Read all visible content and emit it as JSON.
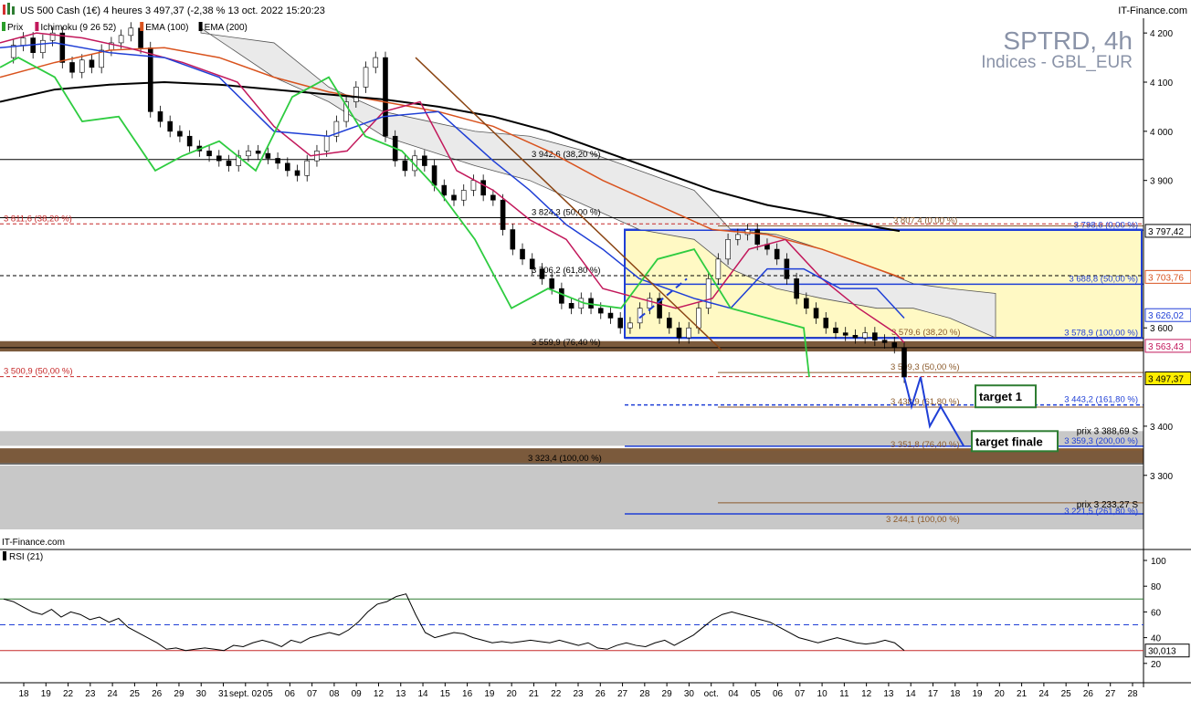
{
  "header": {
    "title": "US 500 Cash (1€) 4 heures 3 497,37 (-2,38 % 13 oct. 2022 15:20:23",
    "source": "IT-Finance.com"
  },
  "legend": [
    {
      "label": "Prix",
      "color": "#2a9d2a"
    },
    {
      "label": "Ichimoku (9 26 52)",
      "color": "#c2185b"
    },
    {
      "label": "EMA (100)",
      "color": "#d9531e"
    },
    {
      "label": "EMA (200)",
      "color": "#000000"
    }
  ],
  "watermark": {
    "symbol": "SPTRD, 4h",
    "sub": "Indices - GBL_EUR",
    "source": "IT-Finance.com"
  },
  "chart_data": {
    "type": "candlestick",
    "price_axis": {
      "min": 3190,
      "max": 4230,
      "ticks": [
        4200,
        4100,
        4000,
        3900,
        3600,
        3400,
        3300
      ]
    },
    "date_labels": [
      "18",
      "19",
      "22",
      "23",
      "24",
      "25",
      "26",
      "29",
      "30",
      "31",
      "sept. 02",
      "05",
      "06",
      "07",
      "08",
      "09",
      "12",
      "13",
      "14",
      "15",
      "16",
      "19",
      "20",
      "21",
      "22",
      "23",
      "26",
      "27",
      "28",
      "29",
      "30",
      "oct.",
      "04",
      "05",
      "06",
      "07",
      "10",
      "11",
      "12",
      "13",
      "14",
      "17",
      "18",
      "19",
      "20",
      "21",
      "24",
      "25",
      "26",
      "27",
      "28"
    ],
    "price_tags": [
      {
        "label": "3 797,42",
        "value": 3797.42,
        "bg": "#ffffff",
        "fg": "#000000",
        "border": "#000000"
      },
      {
        "label": "3 703,76",
        "value": 3703.76,
        "bg": "#ffffff",
        "fg": "#d9531e",
        "border": "#d9531e"
      },
      {
        "label": "3 626,02",
        "value": 3626.02,
        "bg": "#ffffff",
        "fg": "#1f3fd6",
        "border": "#1f3fd6"
      },
      {
        "label": "3 563,43",
        "value": 3563.43,
        "bg": "#ffffff",
        "fg": "#c2185b",
        "border": "#c2185b"
      },
      {
        "label": "3 497,37",
        "value": 3497.37,
        "bg": "#ffee00",
        "fg": "#000000",
        "border": "#000000"
      }
    ],
    "levels": [
      {
        "label": "3 942,6 (38,20 %)",
        "value": 3942.6,
        "color": "#000000",
        "style": "solid"
      },
      {
        "label": "3 824,3 (50,00 %)",
        "value": 3824.3,
        "color": "#000000",
        "style": "solid"
      },
      {
        "label": "3 811,6 (38,20 %)",
        "value": 3811.6,
        "color": "#c62828",
        "style": "dashed"
      },
      {
        "label": "3 807,4 (0,00 %)",
        "value": 3807.4,
        "color": "#8b5a2b",
        "style": "solid"
      },
      {
        "label": "3 798,6 (0,00 %)",
        "value": 3798.6,
        "color": "#1f3fd6",
        "style": "solid"
      },
      {
        "label": "3 706,2 (61,80 %)",
        "value": 3706.2,
        "color": "#000000",
        "style": "dashed"
      },
      {
        "label": "3 688,8 (50,00 %)",
        "value": 3688.8,
        "color": "#1f3fd6",
        "style": "solid"
      },
      {
        "label": "3 579,6 (38,20 %)",
        "value": 3579.6,
        "color": "#8b5a2b",
        "style": "solid"
      },
      {
        "label": "3 578,9 (100,00 %)",
        "value": 3578.9,
        "color": "#1f3fd6",
        "style": "solid"
      },
      {
        "label": "3 559,9 (76,40 %)",
        "value": 3559.9,
        "color": "#000000",
        "style": "solid"
      },
      {
        "label": "3 509,3 (50,00 %)",
        "value": 3509.3,
        "color": "#8b5a2b",
        "style": "solid"
      },
      {
        "label": "3 500,9 (50,00 %)",
        "value": 3500.9,
        "color": "#c62828",
        "style": "dashed"
      },
      {
        "label": "3 443,2 (161,80 %)",
        "value": 3443.2,
        "color": "#1f3fd6",
        "style": "dashed"
      },
      {
        "label": "3 438,9 (61,80 %)",
        "value": 3438.9,
        "color": "#8b5a2b",
        "style": "solid"
      },
      {
        "label": "3 359,3 (200,00 %)",
        "value": 3359.3,
        "color": "#1f3fd6",
        "style": "solid"
      },
      {
        "label": "3 351,8 (76,40 %)",
        "value": 3351.8,
        "color": "#8b5a2b",
        "style": "solid"
      },
      {
        "label": "3 323,4 (100,00 %)",
        "value": 3323.4,
        "color": "#000000",
        "style": "solid"
      },
      {
        "label": "3 221,5 (261,80 %)",
        "value": 3221.5,
        "color": "#1f3fd6",
        "style": "solid"
      },
      {
        "label": "3 244,1 (100,00 %)",
        "value": 3244.1,
        "color": "#8b5a2b",
        "style": "solid"
      }
    ],
    "annotations": [
      {
        "text": "prix 3 388,69 S"
      },
      {
        "text": "prix 3 233,27 S"
      },
      {
        "text": "target 1"
      },
      {
        "text": "target finale"
      }
    ],
    "rsi": {
      "label": "RSI (21)",
      "ticks": [
        100,
        80,
        60,
        40,
        20
      ],
      "last_value": "30,013",
      "levels": [
        70,
        50,
        30
      ],
      "values": [
        70,
        68,
        64,
        60,
        58,
        62,
        56,
        60,
        58,
        54,
        56,
        52,
        55,
        48,
        44,
        40,
        36,
        31,
        32,
        30,
        31,
        32,
        31,
        30,
        34,
        33,
        36,
        38,
        36,
        33,
        38,
        36,
        40,
        42,
        44,
        42,
        46,
        52,
        60,
        66,
        68,
        72,
        74,
        58,
        44,
        40,
        42,
        44,
        43,
        40,
        38,
        36,
        37,
        36,
        37,
        38,
        37,
        36,
        38,
        36,
        34,
        36,
        32,
        31,
        34,
        36,
        34,
        33,
        36,
        38,
        34,
        38,
        42,
        48,
        54,
        58,
        60,
        58,
        56,
        54,
        52,
        48,
        44,
        40,
        38,
        36,
        38,
        40,
        38,
        36,
        35,
        36,
        38,
        36,
        30
      ]
    }
  },
  "ui": {
    "rsi_label": "RSI (21)",
    "rsi_last": "30,013",
    "target1": "target 1",
    "target_finale": "target finale",
    "prix1": "prix 3 388,69 S",
    "prix2": "prix 3 233,27 S"
  }
}
